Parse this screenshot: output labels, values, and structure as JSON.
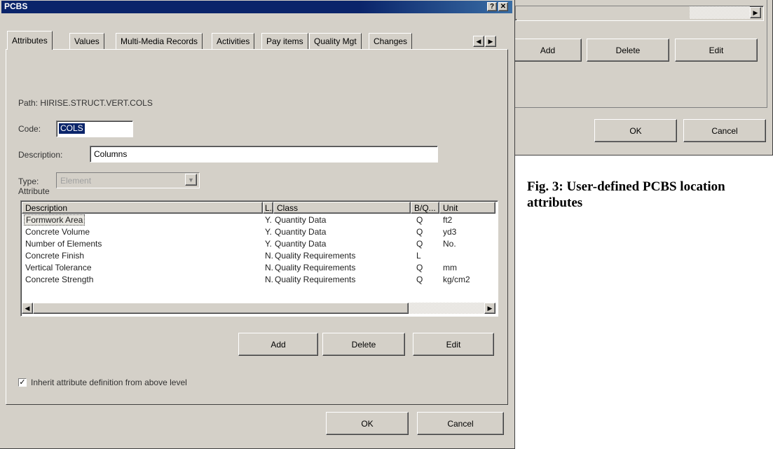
{
  "window": {
    "title": "PCBS",
    "help_button": "?",
    "close_button": "✕"
  },
  "tabs": [
    {
      "label": "Attributes"
    },
    {
      "label": "Values"
    },
    {
      "label": "Multi-Media Records"
    },
    {
      "label": "Activities"
    },
    {
      "label": "Pay items"
    },
    {
      "label": "Quality Mgt"
    },
    {
      "label": "Changes"
    }
  ],
  "form": {
    "path": "Path: HIRISE.STRUCT.VERT.COLS",
    "code_label": "Code:",
    "code_value": "COLS",
    "description_label": "Description:",
    "description_value": "Columns",
    "type_label": "Type:",
    "type_value": "Element",
    "attribute_label": "Attribute"
  },
  "attribute_table": {
    "columns": [
      "Description",
      "L..",
      "Class",
      "B/Q...",
      "Unit"
    ],
    "rows": [
      {
        "description": "Formwork Area",
        "l": "Y.",
        "class": "Quantity Data",
        "bq": "Q",
        "unit": "ft2"
      },
      {
        "description": "Concrete Volume",
        "l": "Y.",
        "class": "Quantity Data",
        "bq": "Q",
        "unit": "yd3"
      },
      {
        "description": "Number of Elements",
        "l": "Y.",
        "class": "Quantity Data",
        "bq": "Q",
        "unit": "No."
      },
      {
        "description": "Concrete Finish",
        "l": "N.",
        "class": "Quality Requirements",
        "bq": "L",
        "unit": ""
      },
      {
        "description": "Vertical Tolerance",
        "l": "N.",
        "class": "Quality Requirements",
        "bq": "Q",
        "unit": "mm"
      },
      {
        "description": "Concrete Strength",
        "l": "N.",
        "class": "Quality Requirements",
        "bq": "Q",
        "unit": "kg/cm2"
      }
    ]
  },
  "buttons": {
    "add": "Add",
    "delete": "Delete",
    "edit": "Edit",
    "ok": "OK",
    "cancel": "Cancel"
  },
  "inherit_checkbox": {
    "label": "Inherit attribute definition from above level",
    "checked": true
  },
  "background_dialog": {
    "add": "Add",
    "delete": "Delete",
    "edit": "Edit",
    "ok": "OK",
    "cancel": "Cancel"
  },
  "caption": "Fig. 3: User-defined PCBS location attributes",
  "colors": {
    "titlebar": "#0a246a",
    "face": "#d4d0c8",
    "selection": "#0a246a"
  }
}
